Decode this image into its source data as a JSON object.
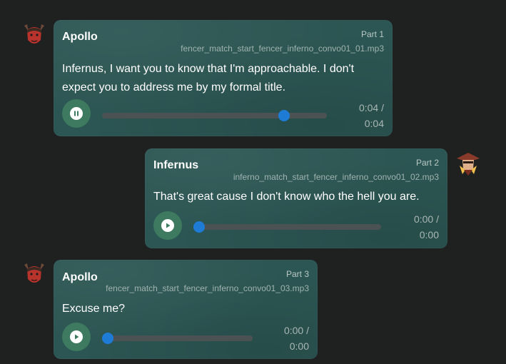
{
  "messages": [
    {
      "speaker": "Apollo",
      "part": "Part 1",
      "file": "fencer_match_start_fencer_inferno_convo01_01.mp3",
      "text": "Infernus, I want you to know that I'm approachable. I don't expect you to address me by my formal title.",
      "time_current": "0:04 /",
      "time_total": "0:04",
      "state": "playing",
      "progress": 1.0,
      "avatar": "apollo-avatar-icon"
    },
    {
      "speaker": "Infernus",
      "part": "Part 2",
      "file": "inferno_match_start_fencer_inferno_convo01_02.mp3",
      "text": "That's great cause I don't know who the hell you are.",
      "time_current": "0:00 /",
      "time_total": "0:00",
      "state": "paused",
      "progress": 0.0,
      "avatar": "infernus-avatar-icon"
    },
    {
      "speaker": "Apollo",
      "part": "Part 3",
      "file": "fencer_match_start_fencer_inferno_convo01_03.mp3",
      "text": "Excuse me?",
      "time_current": "0:00 /",
      "time_total": "0:00",
      "state": "paused",
      "progress": 0.0,
      "avatar": "apollo-avatar-icon"
    }
  ],
  "colors": {
    "background": "#1f2020",
    "bubble": "#2c5653",
    "play_button": "#3d7a5f",
    "progress_knob": "#1e7bd6",
    "track": "#4a5254"
  }
}
